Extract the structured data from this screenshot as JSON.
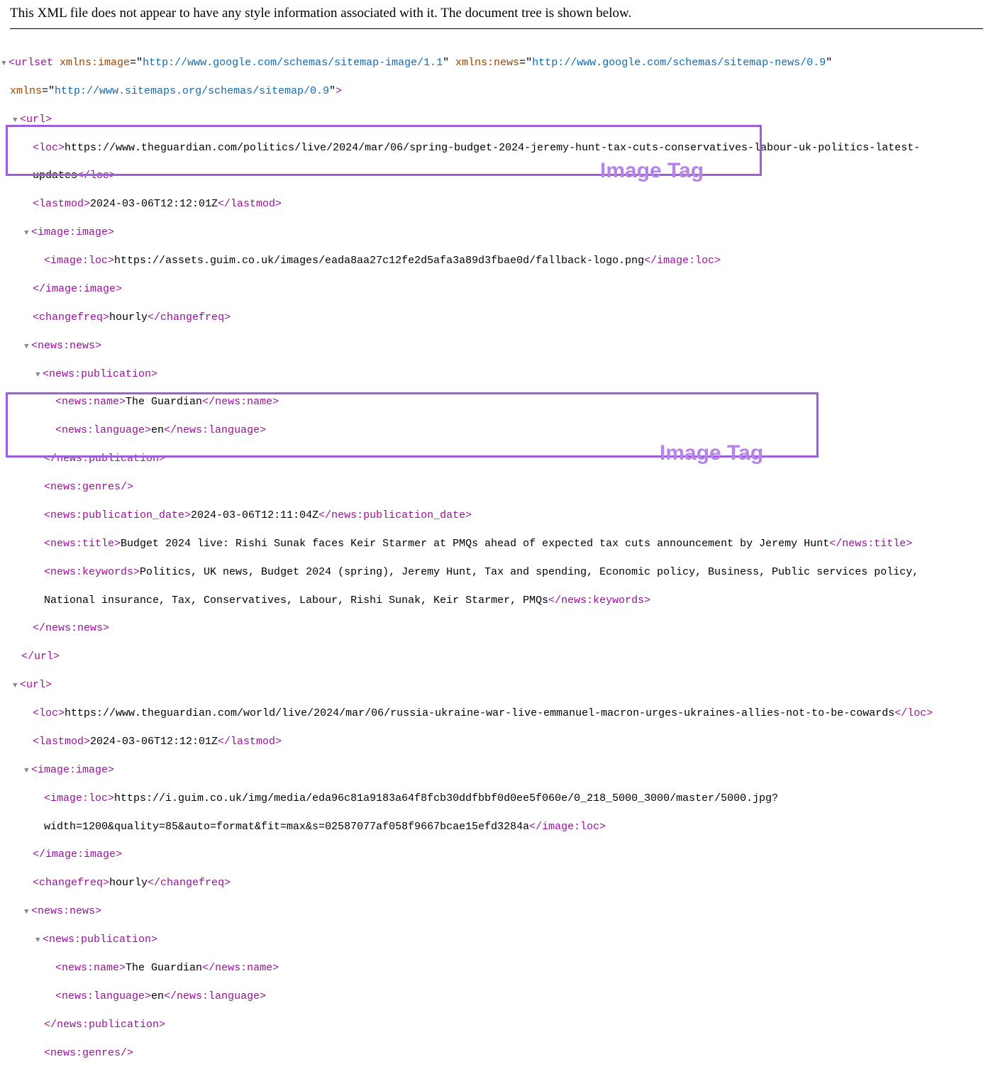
{
  "header_message": "This XML file does not appear to have any style information associated with it. The document tree is shown below.",
  "root": {
    "tag": "urlset",
    "attrs": [
      {
        "name": "xmlns:image",
        "value": "http://www.google.com/schemas/sitemap-image/1.1",
        "quoted_link": true
      },
      {
        "name": "xmlns:news",
        "value": "http://www.google.com/schemas/sitemap-news/0.9",
        "quoted_link": true
      },
      {
        "name": "xmlns",
        "value": "http://www.sitemaps.org/schemas/sitemap/0.9",
        "quoted_link": true
      }
    ]
  },
  "url1": {
    "loc": "https://www.theguardian.com/politics/live/2024/mar/06/spring-budget-2024-jeremy-hunt-tax-cuts-conservatives-labour-uk-politics-latest-updates",
    "lastmod": "2024-03-06T12:12:01Z",
    "image_loc": "https://assets.guim.co.uk/images/eada8aa27c12fe2d5afa3a89d3fbae0d/fallback-logo.png",
    "changefreq": "hourly",
    "news_name": "The Guardian",
    "news_language": "en",
    "news_pubdate": "2024-03-06T12:11:04Z",
    "news_title": "Budget 2024 live: Rishi Sunak faces Keir Starmer at PMQs ahead of expected tax cuts announcement by Jeremy Hunt",
    "news_keywords": "Politics, UK news, Budget 2024 (spring), Jeremy Hunt, Tax and spending, Economic policy, Business, Public services policy, National insurance, Tax, Conservatives, Labour, Rishi Sunak, Keir Starmer, PMQs"
  },
  "url2": {
    "loc": "https://www.theguardian.com/world/live/2024/mar/06/russia-ukraine-war-live-emmanuel-macron-urges-ukraines-allies-not-to-be-cowards",
    "lastmod": "2024-03-06T12:12:01Z",
    "image_loc_line1": "https://i.guim.co.uk/img/media/eda96c81a9183a64f8fcb30ddfbbf0d0ee5f060e/0_218_5000_3000/master/5000.jpg?",
    "image_loc_line2": "width=1200&quality=85&auto=format&fit=max&s=02587077af058f9667bcae15efd3284a",
    "changefreq": "hourly",
    "news_name": "The Guardian",
    "news_language": "en"
  },
  "annotation1": "Image Tag",
  "annotation2": "Image Tag",
  "tags": {
    "url_open": "<url>",
    "url_close": "</url>",
    "loc_open": "<loc>",
    "loc_close": "</loc>",
    "lastmod_open": "<lastmod>",
    "lastmod_close": "</lastmod>",
    "image_image_open": "<image:image>",
    "image_image_close": "</image:image>",
    "image_loc_open": "<image:loc>",
    "image_loc_close": "</image:loc>",
    "changefreq_open": "<changefreq>",
    "changefreq_close": "</changefreq>",
    "news_news_open": "<news:news>",
    "news_news_close": "</news:news>",
    "news_pub_open": "<news:publication>",
    "news_pub_close": "</news:publication>",
    "news_name_open": "<news:name>",
    "news_name_close": "</news:name>",
    "news_lang_open": "<news:language>",
    "news_lang_close": "</news:language>",
    "news_genres": "<news:genres/>",
    "news_pubdate_open": "<news:publication_date>",
    "news_pubdate_close": "</news:publication_date>",
    "news_title_open": "<news:title>",
    "news_title_close": "</news:title>",
    "news_keywords_open": "<news:keywords>",
    "news_keywords_close": "</news:keywords>"
  }
}
